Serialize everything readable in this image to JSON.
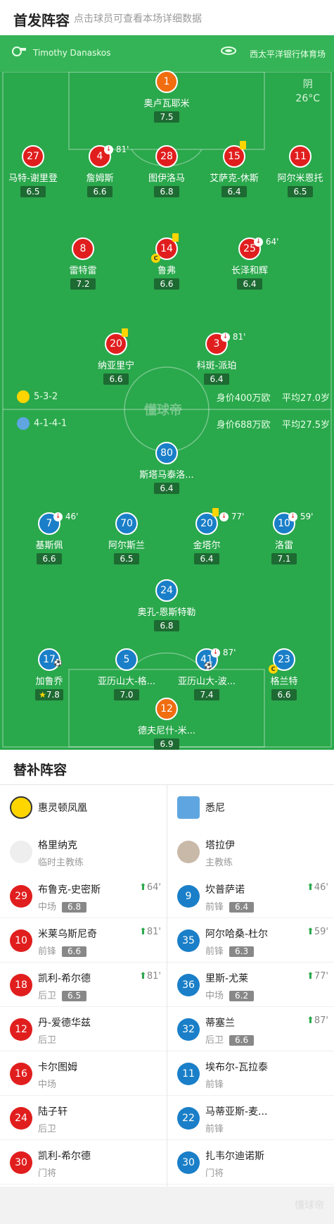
{
  "header": {
    "title": "首发阵容",
    "subtitle": "点击球员可查看本场详细数据"
  },
  "match": {
    "referee": "Timothy Danaskos",
    "venue": "西太平洋银行体育场",
    "weather": "阴",
    "temperature": "26°C"
  },
  "home": {
    "formation": "5-3-2",
    "value": "身价400万欧",
    "avg_age": "平均27.0岁",
    "color": "#e11e1e"
  },
  "away": {
    "formation": "4-1-4-1",
    "value": "身价688万欧",
    "avg_age": "平均27.5岁",
    "color": "#1a7fc8"
  },
  "watermark": "懂球帝",
  "home_players": [
    {
      "num": "1",
      "name": "奥卢瓦耶米",
      "rating": "7.5"
    },
    {
      "num": "27",
      "name": "马特-谢里登",
      "rating": "6.5"
    },
    {
      "num": "4",
      "name": "詹姆斯",
      "rating": "6.6",
      "event": "81'"
    },
    {
      "num": "28",
      "name": "图伊洛马",
      "rating": "6.8"
    },
    {
      "num": "15",
      "name": "艾萨克-休斯",
      "rating": "6.4"
    },
    {
      "num": "11",
      "name": "阿尔米恩托",
      "rating": "6.5"
    },
    {
      "num": "8",
      "name": "雷特雷",
      "rating": "7.2"
    },
    {
      "num": "14",
      "name": "鲁弗",
      "rating": "6.6"
    },
    {
      "num": "25",
      "name": "长泽和辉",
      "rating": "6.4",
      "event": "64'"
    },
    {
      "num": "20",
      "name": "纳亚里宁",
      "rating": "6.6"
    },
    {
      "num": "3",
      "name": "科斑-派珀",
      "rating": "6.4",
      "event": "81'"
    }
  ],
  "away_players": [
    {
      "num": "80",
      "name": "斯塔马泰洛...",
      "rating": "6.4"
    },
    {
      "num": "7",
      "name": "基斯佩",
      "rating": "6.6",
      "event": "46'"
    },
    {
      "num": "70",
      "name": "阿尔斯兰",
      "rating": "6.5"
    },
    {
      "num": "20",
      "name": "金塔尔",
      "rating": "6.4",
      "event": "77'"
    },
    {
      "num": "10",
      "name": "洛雷",
      "rating": "7.1",
      "event": "59'"
    },
    {
      "num": "24",
      "name": "奥孔-恩斯特勒",
      "rating": "6.8"
    },
    {
      "num": "17",
      "name": "加鲁乔",
      "rating": "7.8"
    },
    {
      "num": "5",
      "name": "亚历山大-格...",
      "rating": "7.0"
    },
    {
      "num": "41",
      "name": "亚历山大-波...",
      "rating": "7.4",
      "event": "87'"
    },
    {
      "num": "23",
      "name": "格兰特",
      "rating": "6.6"
    },
    {
      "num": "12",
      "name": "德夫尼什-米...",
      "rating": "6.9"
    }
  ],
  "subs": {
    "title": "替补阵容",
    "home": {
      "team": "惠灵顿凤凰",
      "coach": {
        "name": "格里纳克",
        "role": "临时主教练"
      },
      "players": [
        {
          "num": "29",
          "name": "布鲁克-史密斯",
          "pos": "中场",
          "rating": "6.8",
          "time": "64'"
        },
        {
          "num": "10",
          "name": "米莱乌斯尼奇",
          "pos": "前锋",
          "rating": "6.6",
          "time": "81'"
        },
        {
          "num": "18",
          "name": "凯利-希尔德",
          "pos": "后卫",
          "rating": "6.5",
          "time": "81'"
        },
        {
          "num": "12",
          "name": "丹-爱德华兹",
          "pos": "后卫"
        },
        {
          "num": "16",
          "name": "卡尔图姆",
          "pos": "中场"
        },
        {
          "num": "24",
          "name": "陆子轩",
          "pos": "后卫"
        },
        {
          "num": "30",
          "name": "凯利-希尔德",
          "pos": "门将"
        }
      ]
    },
    "away": {
      "team": "悉尼",
      "coach": {
        "name": "塔拉伊",
        "role": "主教练"
      },
      "players": [
        {
          "num": "9",
          "name": "坎普萨诺",
          "pos": "前锋",
          "rating": "6.4",
          "time": "46'"
        },
        {
          "num": "35",
          "name": "阿尔哈桑-杜尔",
          "pos": "前锋",
          "rating": "6.3",
          "time": "59'"
        },
        {
          "num": "36",
          "name": "里斯-尤莱",
          "pos": "中场",
          "rating": "6.2",
          "time": "77'"
        },
        {
          "num": "32",
          "name": "蒂塞兰",
          "pos": "后卫",
          "rating": "6.6",
          "time": "87'"
        },
        {
          "num": "11",
          "name": "埃布尔-瓦拉泰",
          "pos": "前锋"
        },
        {
          "num": "22",
          "name": "马蒂亚斯-麦...",
          "pos": "前锋"
        },
        {
          "num": "30",
          "name": "扎韦尔迪诺斯",
          "pos": "门将"
        }
      ]
    }
  },
  "footer_watermark": "懂球帝"
}
